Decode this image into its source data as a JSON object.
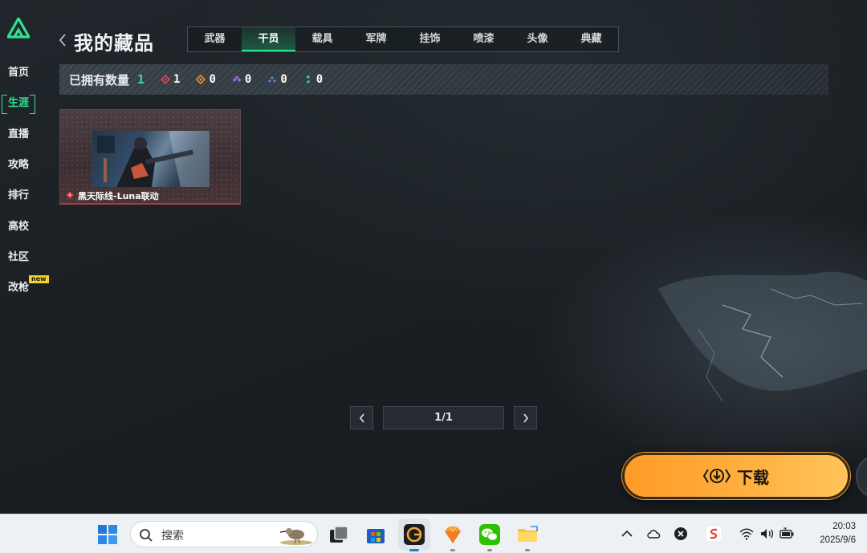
{
  "sidebar": {
    "items": [
      {
        "label": "首页",
        "active": false
      },
      {
        "label": "生涯",
        "active": true
      },
      {
        "label": "直播",
        "active": false
      },
      {
        "label": "攻略",
        "active": false
      },
      {
        "label": "排行",
        "active": false
      },
      {
        "label": "高校",
        "active": false
      },
      {
        "label": "社区",
        "active": false
      },
      {
        "label": "改枪",
        "active": false
      }
    ],
    "new_badge": "new"
  },
  "header": {
    "title": "我的藏品",
    "tabs": [
      {
        "label": "武器",
        "active": false
      },
      {
        "label": "干员",
        "active": true
      },
      {
        "label": "载具",
        "active": false
      },
      {
        "label": "军牌",
        "active": false
      },
      {
        "label": "挂饰",
        "active": false
      },
      {
        "label": "喷漆",
        "active": false
      },
      {
        "label": "头像",
        "active": false
      },
      {
        "label": "典藏",
        "active": false
      }
    ]
  },
  "stats": {
    "owned_label": "已拥有数量",
    "owned_count": "1",
    "rarities": [
      {
        "icon": "red-diamond-icon",
        "color": "#e0414d",
        "count": "1"
      },
      {
        "icon": "orange-diamond-icon",
        "color": "#f08a2a",
        "count": "0"
      },
      {
        "icon": "purple-diamond-icon",
        "color": "#9a68e0",
        "count": "0"
      },
      {
        "icon": "blue-diamond-icon",
        "color": "#4a8fe0",
        "count": "0"
      },
      {
        "icon": "green-dots-icon",
        "color": "#2ee38f",
        "count": "0"
      }
    ]
  },
  "items": [
    {
      "name": "黑天际线-Luna联动",
      "rarity_color": "#e0414d"
    }
  ],
  "pagination": {
    "text": "1/1"
  },
  "download": {
    "label": "下载"
  },
  "taskbar": {
    "search_placeholder": "搜索",
    "time": "20:03",
    "date": "2025/9/6"
  },
  "colors": {
    "accent": "#2ee38f",
    "download": "#ffb03f"
  }
}
